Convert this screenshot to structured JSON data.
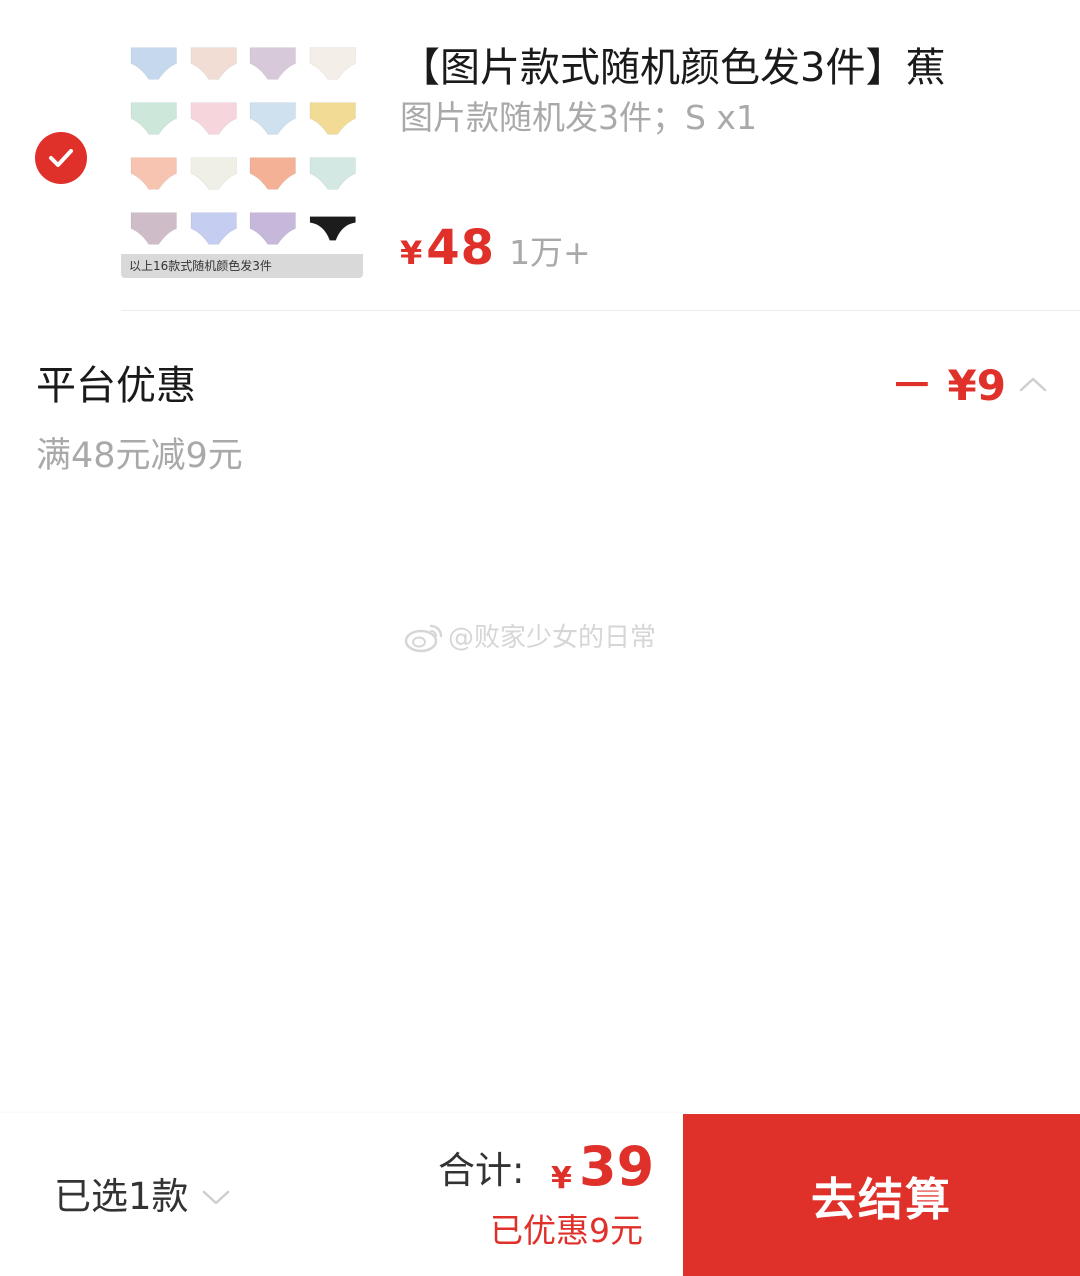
{
  "product": {
    "title": "【图片款式随机颜色发3件】蕉",
    "spec": "图片款随机发3件；S x1",
    "price_symbol": "¥",
    "price": "48",
    "sales": "1万+",
    "image_caption": "以上16款式随机颜色发3件",
    "selected": true,
    "swatch_colors": [
      "#c6d8ee",
      "#f1ddd4",
      "#d8c9da",
      "#f3efe8",
      "#cde7da",
      "#f6d6dc",
      "#cfe0ee",
      "#f2dc95",
      "#f7c4b1",
      "#f0efe6",
      "#f4b196",
      "#d3e8e3",
      "#cfbcc9",
      "#c5cdf0",
      "#c5b8da",
      "#1c1c1c"
    ]
  },
  "discount": {
    "title": "平台优惠",
    "amount": "－ ¥9",
    "rule": "满48元减9元"
  },
  "watermark": {
    "text": "@败家少女的日常"
  },
  "bottom_bar": {
    "selected_count": "已选1款",
    "total_label": "合计:",
    "total_symbol": "¥",
    "total_value": "39",
    "saved_text": "已优惠9元",
    "checkout_label": "去结算"
  },
  "colors": {
    "accent": "#e0302a",
    "muted_text": "#a9a9a9"
  }
}
